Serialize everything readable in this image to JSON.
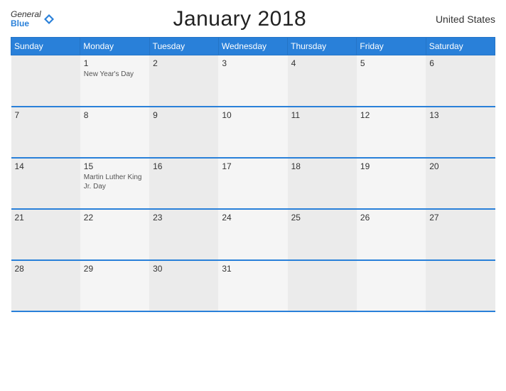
{
  "header": {
    "logo_general": "General",
    "logo_blue": "Blue",
    "title": "January 2018",
    "country": "United States"
  },
  "weekdays": [
    "Sunday",
    "Monday",
    "Tuesday",
    "Wednesday",
    "Thursday",
    "Friday",
    "Saturday"
  ],
  "weeks": [
    [
      {
        "num": "",
        "holiday": ""
      },
      {
        "num": "1",
        "holiday": "New Year's Day"
      },
      {
        "num": "2",
        "holiday": ""
      },
      {
        "num": "3",
        "holiday": ""
      },
      {
        "num": "4",
        "holiday": ""
      },
      {
        "num": "5",
        "holiday": ""
      },
      {
        "num": "6",
        "holiday": ""
      }
    ],
    [
      {
        "num": "7",
        "holiday": ""
      },
      {
        "num": "8",
        "holiday": ""
      },
      {
        "num": "9",
        "holiday": ""
      },
      {
        "num": "10",
        "holiday": ""
      },
      {
        "num": "11",
        "holiday": ""
      },
      {
        "num": "12",
        "holiday": ""
      },
      {
        "num": "13",
        "holiday": ""
      }
    ],
    [
      {
        "num": "14",
        "holiday": ""
      },
      {
        "num": "15",
        "holiday": "Martin Luther King Jr. Day"
      },
      {
        "num": "16",
        "holiday": ""
      },
      {
        "num": "17",
        "holiday": ""
      },
      {
        "num": "18",
        "holiday": ""
      },
      {
        "num": "19",
        "holiday": ""
      },
      {
        "num": "20",
        "holiday": ""
      }
    ],
    [
      {
        "num": "21",
        "holiday": ""
      },
      {
        "num": "22",
        "holiday": ""
      },
      {
        "num": "23",
        "holiday": ""
      },
      {
        "num": "24",
        "holiday": ""
      },
      {
        "num": "25",
        "holiday": ""
      },
      {
        "num": "26",
        "holiday": ""
      },
      {
        "num": "27",
        "holiday": ""
      }
    ],
    [
      {
        "num": "28",
        "holiday": ""
      },
      {
        "num": "29",
        "holiday": ""
      },
      {
        "num": "30",
        "holiday": ""
      },
      {
        "num": "31",
        "holiday": ""
      },
      {
        "num": "",
        "holiday": ""
      },
      {
        "num": "",
        "holiday": ""
      },
      {
        "num": "",
        "holiday": ""
      }
    ]
  ]
}
